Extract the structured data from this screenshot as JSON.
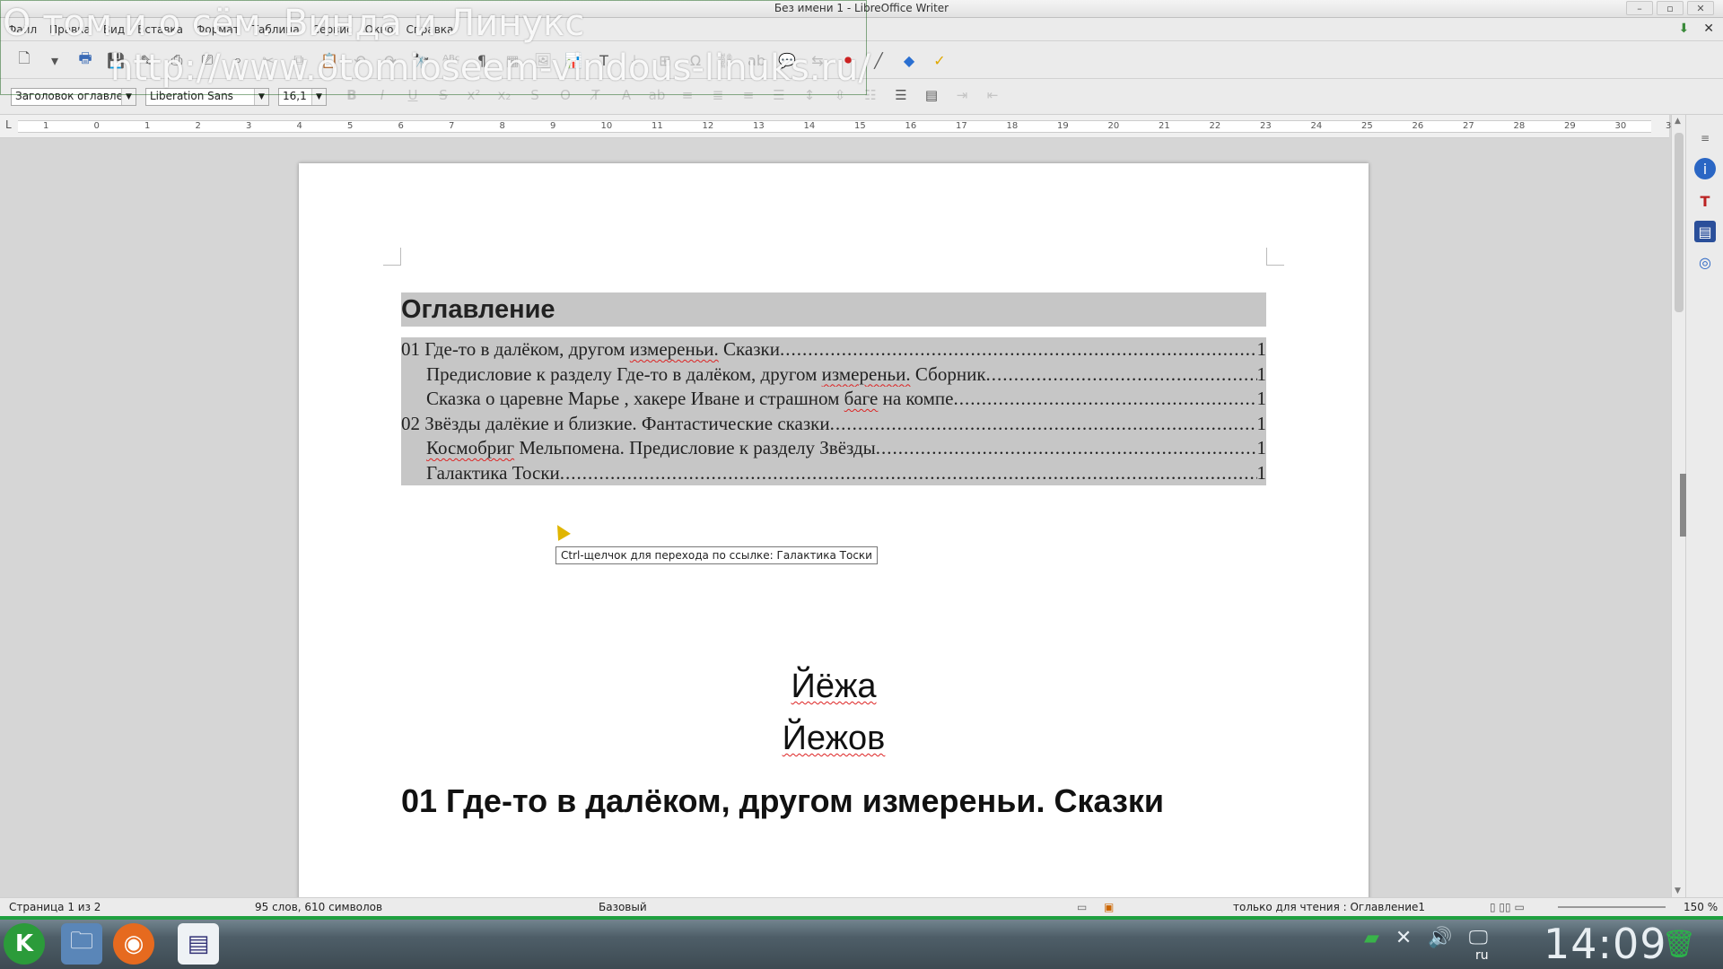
{
  "window": {
    "title": "Без имени 1 - LibreOffice Writer"
  },
  "menubar": {
    "items": [
      "Файл",
      "Правка",
      "Вид",
      "Вставка",
      "Формат",
      "Таблица",
      "Сервис",
      "Окно",
      "Справка"
    ]
  },
  "format_toolbar": {
    "paragraph_style": "Заголовок оглавле",
    "font_name": "Liberation Sans",
    "font_size": "16,1"
  },
  "ruler": {
    "marks": [
      "1",
      "0",
      "1",
      "2",
      "3",
      "4",
      "5",
      "6",
      "7",
      "8",
      "9",
      "10",
      "11",
      "12",
      "13",
      "14",
      "15",
      "16",
      "17",
      "18",
      "19",
      "20",
      "21",
      "22",
      "23",
      "24",
      "25",
      "26",
      "27",
      "28",
      "29",
      "30",
      "31"
    ]
  },
  "document": {
    "toc_heading": "Оглавление",
    "toc_entries": [
      {
        "level": 1,
        "text": "01 Где-то в далёком, другом измереньи. Сказки",
        "page": "1"
      },
      {
        "level": 2,
        "text": "Предисловие к разделу Где-то в далёком, другом измереньи. Сборник",
        "page": "1"
      },
      {
        "level": 2,
        "text": "Сказка о царевне Марье , хакере Иване и страшном  баге на компе",
        "page": "1"
      },
      {
        "level": 1,
        "text": "02 Звёзды далёкие и близкие. Фантастические сказки",
        "page": "1"
      },
      {
        "level": 2,
        "text": "Космобриг Мельпомена. Предисловие к разделу Звёзды",
        "page": "1"
      },
      {
        "level": 2,
        "text": "Галактика Тоски",
        "page": "1"
      }
    ],
    "tooltip": "Ctrl-щелчок для перехода по ссылке: Галактика Тоски",
    "author_first": "Йёжа",
    "author_last": "Йежов",
    "section_heading": "01 Где-то в далёком, другом измереньи. Сказки"
  },
  "statusbar": {
    "page": "Страница 1 из 2",
    "word_count": "95 слов, 610 символов",
    "page_style": "Базовый",
    "mode": "только для чтения : Оглавление1",
    "zoom": "150 %"
  },
  "taskbar": {
    "clock": "14:09",
    "keyboard_layout": "ru"
  },
  "watermark": {
    "line1": "О том и о сём. Винда и Линукс",
    "line2": "http://www.otomioseem-vindous-linuks.ru/"
  }
}
